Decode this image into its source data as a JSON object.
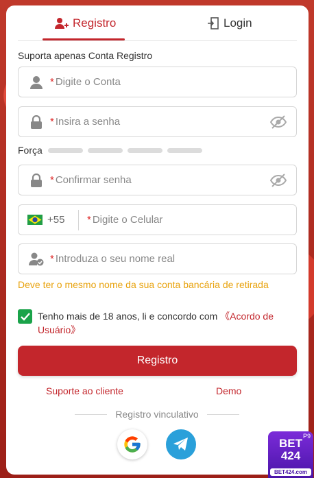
{
  "tabs": {
    "register_label": "Registro",
    "login_label": "Login"
  },
  "form": {
    "hint": "Suporta apenas Conta Registro",
    "account_placeholder": "Digite o Conta",
    "password_placeholder": "Insira a senha",
    "strength_label": "Força",
    "confirm_placeholder": "Confirmar senha",
    "phone_country_code": "+55",
    "phone_placeholder": "Digite o Celular",
    "realname_placeholder": "Introduza o seu nome real",
    "realname_warning": "Deve ter o mesmo nome da sua conta bancária de retirada",
    "agree_text": "Tenho mais de 18 anos, li e concordo com ",
    "agree_link": "《Acordo de Usuário》",
    "required_mark": "*",
    "submit_label": "Registro"
  },
  "links": {
    "support": "Suporte ao cliente",
    "demo": "Demo"
  },
  "social": {
    "divider_text": "Registro vinculativo",
    "providers": [
      "google-icon",
      "telegram-icon"
    ]
  },
  "brand": {
    "line1": "BET",
    "line2": "424",
    "domain": "BET424.com",
    "badge": "P9"
  },
  "colors": {
    "accent": "#c3262c",
    "warning": "#e8a20c",
    "checkbox": "#1aa34a",
    "telegram": "#2aa0da"
  }
}
